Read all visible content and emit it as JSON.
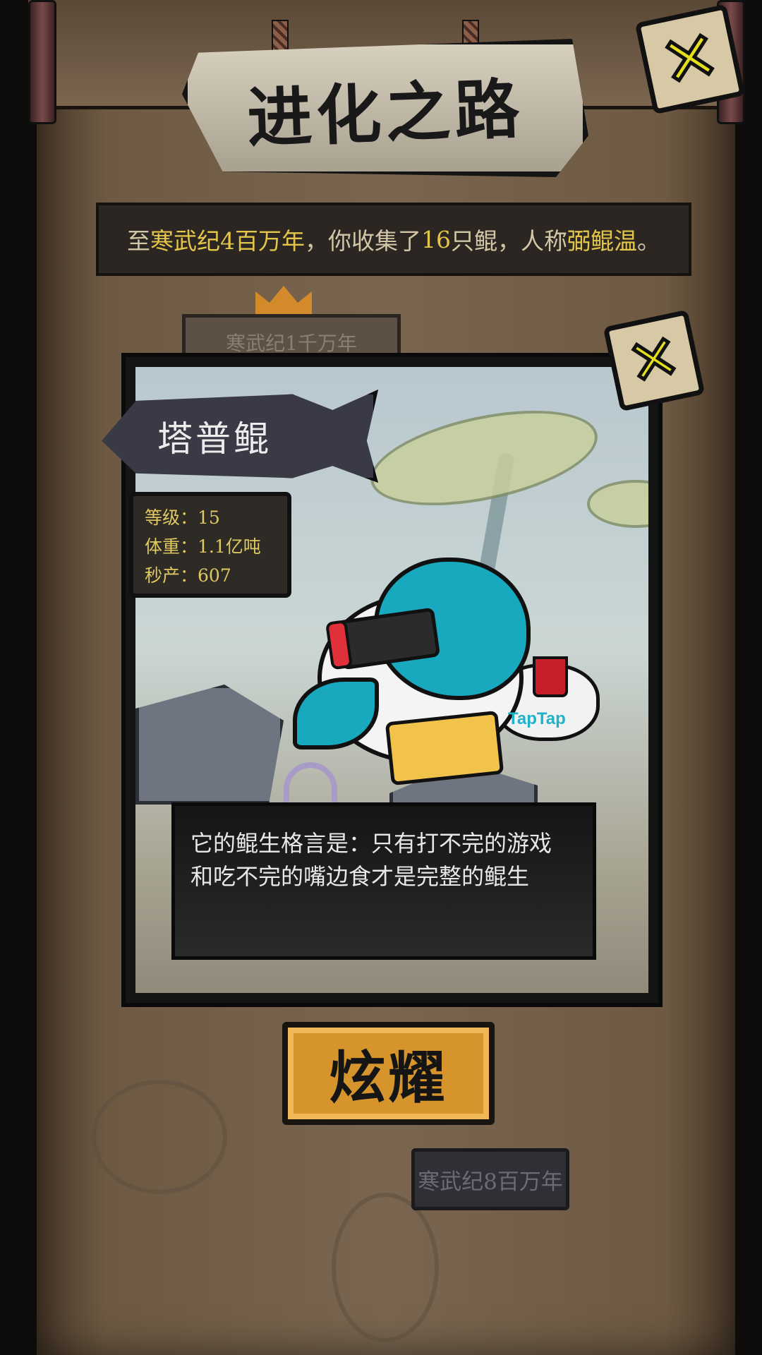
{
  "header": {
    "title": "进化之路"
  },
  "summary": {
    "prefix": "至",
    "era": "寒武纪4百万年",
    "middle1": "，你收集了",
    "count": "16",
    "middle2": "只鲲，人称",
    "nickname": "弼鲲温",
    "suffix": "。"
  },
  "timeline": {
    "faded_sign": "寒武纪1千万年",
    "faded_era": "寒武纪8百万年"
  },
  "card": {
    "name": "塔普鲲",
    "stats": [
      {
        "label": "等级：",
        "value": "15"
      },
      {
        "label": "体重：",
        "value": "1.1亿吨"
      },
      {
        "label": "秒产：",
        "value": "607"
      }
    ],
    "brand": "TapTap",
    "quote_line1": "它的鲲生格言是：只有打不完的游戏",
    "quote_line2": "和吃不完的嘴边食才是完整的鲲生"
  },
  "buttons": {
    "close_main": "✕",
    "close_card": "✕",
    "share": "炫耀"
  },
  "colors": {
    "accent_yellow": "#e6e01a",
    "highlight_text": "#e3c649",
    "share_orange": "#d6952c"
  }
}
